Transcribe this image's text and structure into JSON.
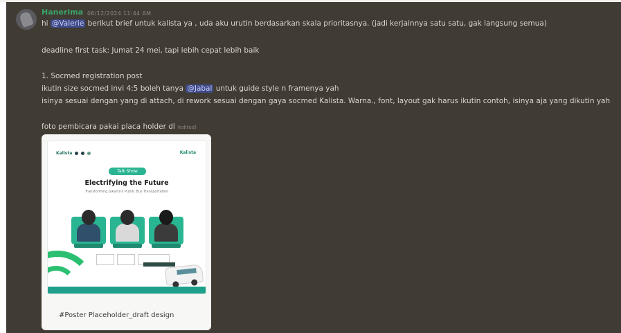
{
  "message": {
    "username": "Hanerima",
    "timestamp": "06/12/2024 11:44 AM",
    "line1_pre": "hi ",
    "mention_valerie": "@Valerie",
    "line1_post": " berikut brief untuk kalista ya , uda aku urutin berdasarkan skala prioritasnya. (jadi kerjainnya satu satu, gak langsung semua)",
    "deadline": "deadline first task: Jumat 24 mei, tapi lebih cepat lebih baik",
    "task_title": "1. Socmed registration post",
    "line4_pre": "ikutin size socmed invi 4:5 boleh tanya ",
    "mention_jabal": "@Jabal",
    "line4_post": " untuk guide style n framenya yah",
    "line5": "isinya sesuai dengan yang di attach, di rework sesuai dengan gaya socmed Kalista. Warna., font, layout gak harus ikutin contoh, isinya aja yang dikutin yah",
    "line6": "foto pembicara pakai placa holder dl",
    "edited": "(edited)"
  },
  "attachment": {
    "caption": "#Poster Placeholder_draft design",
    "poster": {
      "logos_left": "Kalista",
      "logo_right": "Kalista",
      "pill": "Talk Show",
      "title": "Electrifying the Future",
      "subtitle": "Transforming Jakarta's Public Bus Transportation"
    }
  },
  "colors": {
    "background": "#403b33",
    "username": "#3aa36a",
    "mention_bg": "#3f4a86",
    "accent_green": "#2ab592"
  }
}
